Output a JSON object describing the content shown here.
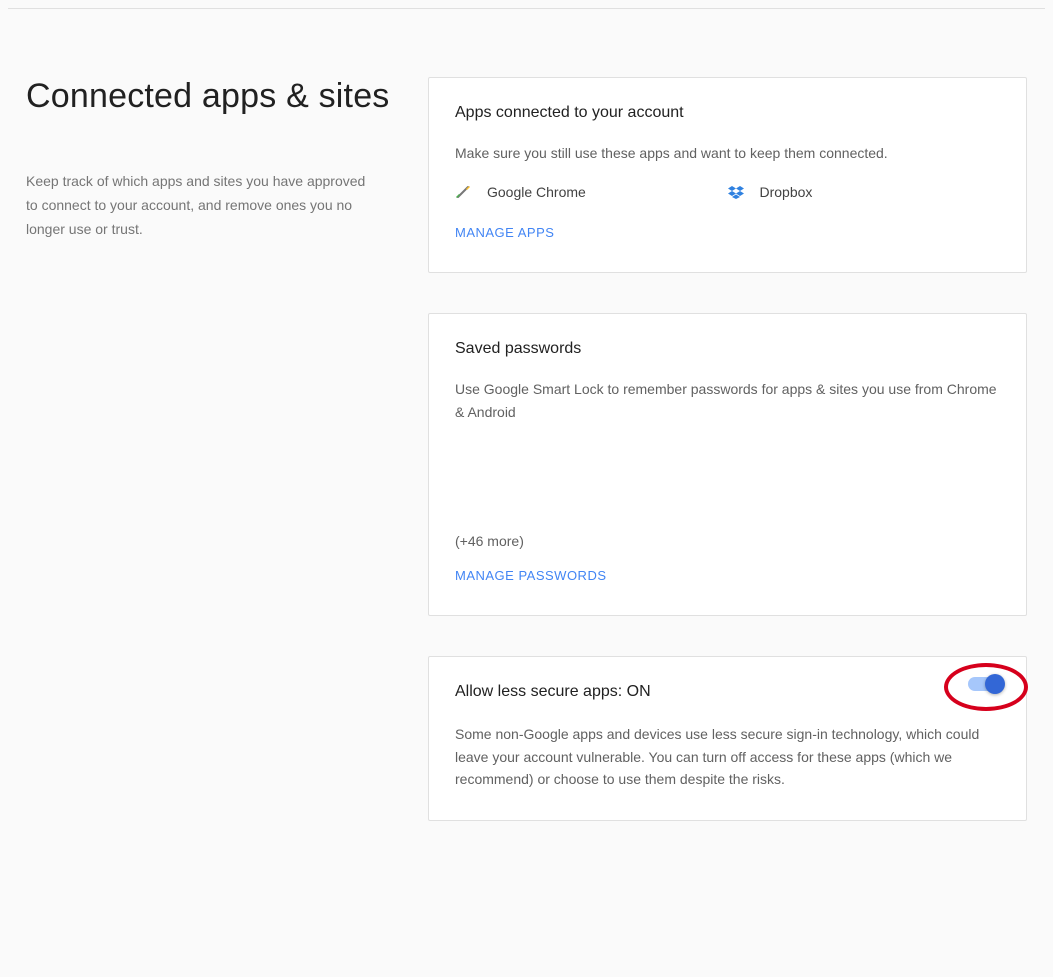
{
  "page": {
    "title": "Connected apps & sites",
    "description": "Keep track of which apps and sites you have approved to connect to your account, and remove ones you no longer use or trust."
  },
  "cards": {
    "connected": {
      "title": "Apps connected to your account",
      "description": "Make sure you still use these apps and want to keep them connected.",
      "apps": [
        {
          "name": "Google Chrome",
          "icon": "chrome-icon"
        },
        {
          "name": "Dropbox",
          "icon": "dropbox-icon"
        }
      ],
      "action": "MANAGE APPS"
    },
    "passwords": {
      "title": "Saved passwords",
      "description": "Use Google Smart Lock to remember passwords for apps & sites you use from Chrome & Android",
      "more": "(+46 more)",
      "action": "MANAGE PASSWORDS"
    },
    "lessSecure": {
      "title": "Allow less secure apps: ON",
      "toggle_state": "on",
      "description": "Some non-Google apps and devices use less secure sign-in technology, which could leave your account vulnerable. You can turn off access for these apps (which we recommend) or choose to use them despite the risks."
    }
  }
}
